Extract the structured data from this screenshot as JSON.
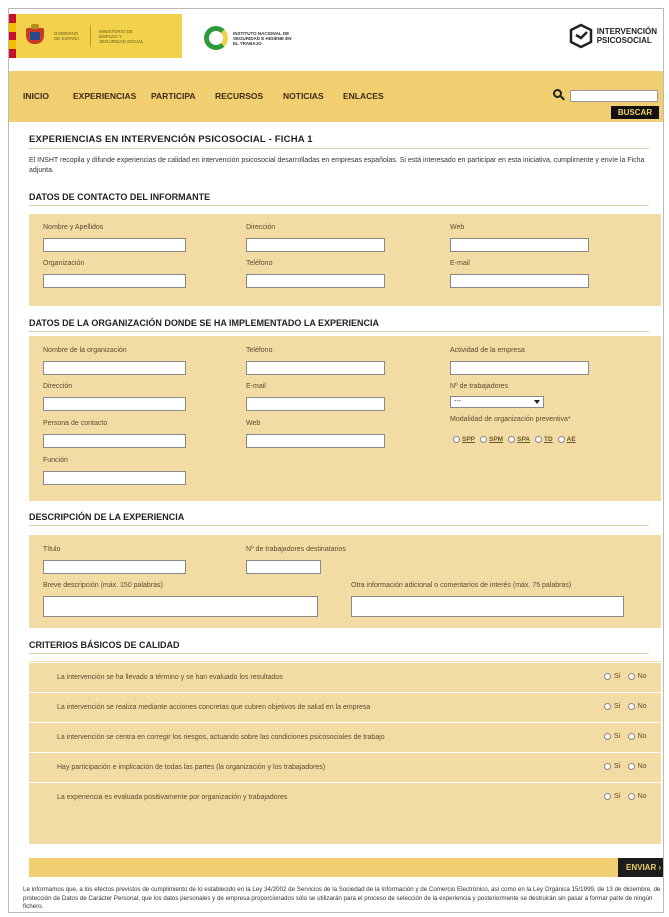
{
  "header": {
    "gov_line1": "Gobierno de España",
    "gov_line2": "Ministerio de Empleo y Seguridad Social",
    "insht_name": "Instituto Nacional de Seguridad e Higiene en el Trabajo",
    "ip_line1": "INTERVENCIÓN",
    "ip_line2": "PSICOSOCIAL",
    "flag_colors": [
      "#c8102e",
      "#f1bf00",
      "#c8102e",
      "#f1bf00",
      "#c8102e"
    ]
  },
  "nav": {
    "items": [
      "INICIO",
      "EXPERIENCIAS",
      "PARTICIPA",
      "RECURSOS",
      "NOTICIAS",
      "ENLACES"
    ],
    "search_placeholder": "",
    "search_button": "BUSCAR"
  },
  "page": {
    "title": "EXPERIENCIAS EN INTERVENCIÓN PSICOSOCIAL - FICHA 1",
    "intro": "El INSHT recopila y difunde experiencias de calidad en intervención psicosocial desarrolladas en empresas españolas. Si está interesado en participar en esta iniciativa, cumplimente y envíe la Ficha adjunta."
  },
  "contact": {
    "heading": "DATOS DE CONTACTO DEL INFORMANTE",
    "labels": {
      "name": "Nombre y Apellidos",
      "address": "Dirección",
      "web": "Web",
      "org": "Organización",
      "phone": "Teléfono",
      "email": "E-mail"
    }
  },
  "organization": {
    "heading": "DATOS DE LA ORGANIZACIÓN DONDE SE HA IMPLEMENTADO LA EXPERIENCIA",
    "labels": {
      "org_name": "Nombre de la organización",
      "phone": "Teléfono",
      "activity": "Actividad de la empresa",
      "address": "Dirección",
      "email": "E-mail",
      "workers": "Nº de trabajadores",
      "contact": "Persona de contacto",
      "web": "Web",
      "modality": "Modalidad de organización preventiva*",
      "function": "Función"
    },
    "workers_selected": "---",
    "modality_options": [
      "SPP",
      "SPM",
      "SPA",
      "TD",
      "AE"
    ]
  },
  "experience": {
    "heading": "DESCRIPCIÓN DE LA EXPERIENCIA",
    "labels": {
      "title": "Título",
      "workers": "Nº de trabajadores destinatarios",
      "brief": "Breve descripción (máx. 150 palabras)",
      "other": "Otra información adicional o comentarios de interés (máx. 75 palabras)"
    }
  },
  "criteria": {
    "heading": "CRITERIOS BÁSICOS DE CALIDAD",
    "yes": "Sí",
    "no": "No",
    "questions": [
      "La intervención se ha llevado a término y se han evaluado los resultados",
      "La intervención se realiza mediante acciones concretas que cubren objetivos de salud en la empresa",
      "La intervención se centra en corregir los riesgos, actuando sobre las condiciones psicosociales de trabajo",
      "Hay participación e implicación de todas las partes (la organización y los trabajadores)",
      "La experiencia es evaluada positivamente por organización y trabajadores"
    ]
  },
  "footer": {
    "submit": "ENVIAR",
    "legal": "Le informamos que, a los efectos previstos de cumplimiento de lo establecido en la Ley 34/2002 de Servicios de la Sociedad de la Información y de Comercio Electrónico, así como en la Ley Orgánica 15/1999, de 13 de diciembre, de protección de Datos de Carácter Personal, que los datos personales y de empresa proporcionados sólo se utilizarán para el proceso de selección de la experiencia y posteriormente se destruirán sin pasar a formar parte de ningún fichero."
  },
  "colors": {
    "nav_bg": "#f1cf70",
    "panel_bg": "#f3dca4",
    "dark": "#1c1c1c"
  }
}
